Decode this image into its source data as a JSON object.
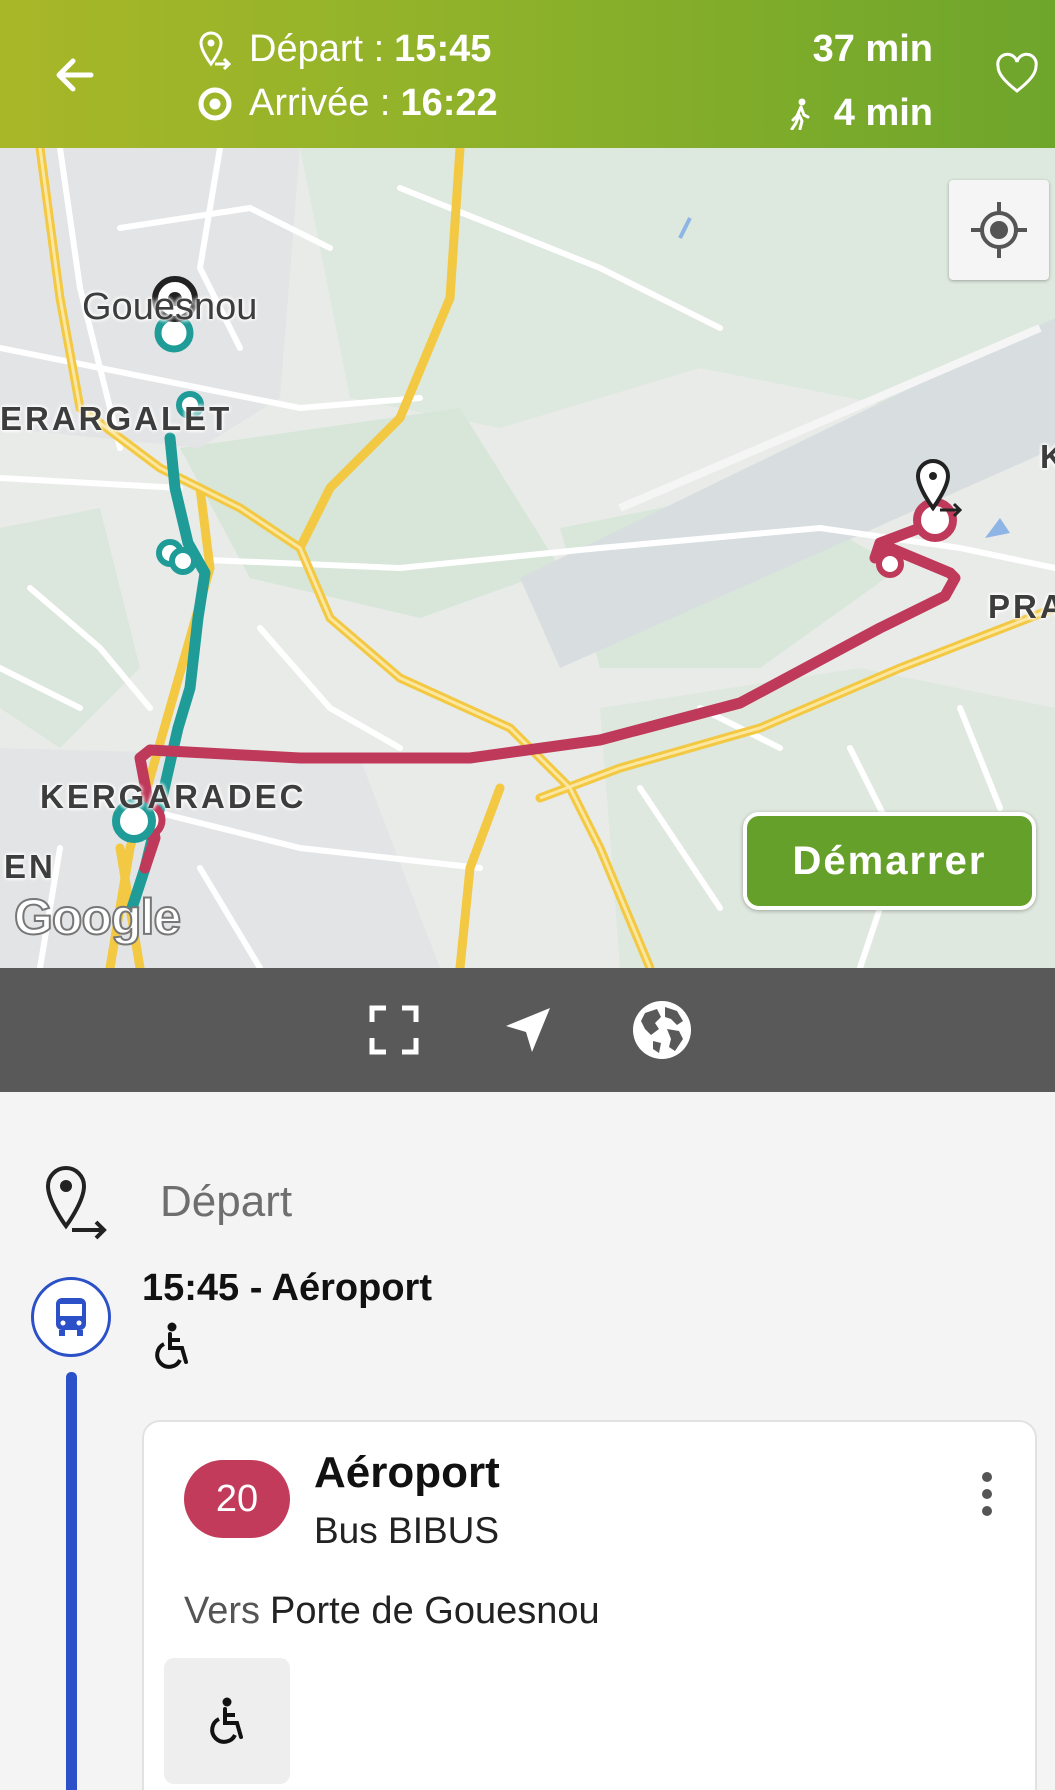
{
  "header": {
    "departure_label": "Départ :",
    "departure_time": "15:45",
    "arrival_label": "Arrivée :",
    "arrival_time": "16:22",
    "duration": "37 min",
    "walk_duration": "4 min",
    "colors": {
      "gradient_start": "#a8b728",
      "gradient_end": "#6ea52b"
    }
  },
  "map": {
    "labels": {
      "town": "Gouesnou",
      "kerargalet": "ERARGALET",
      "kergaradec": "KERGARADEC",
      "en": "EN",
      "pra": "PRA",
      "k": "K"
    },
    "start_button": "Démarrer",
    "attribution": "Google",
    "route_colors": {
      "bus": "#bf3a5a",
      "tram": "#1f9c98"
    }
  },
  "toolbar": {
    "icons": [
      "fullscreen-icon",
      "navigation-arrow-icon",
      "globe-icon"
    ]
  },
  "details": {
    "departure_label": "Départ",
    "stop_title": "15:45 - Aéroport",
    "card": {
      "line_number": "20",
      "line_color": "#c23b5a",
      "title": "Aéroport",
      "subtitle": "Bus BIBUS",
      "towards_prefix": "Vers",
      "towards_dest": "Porte de Gouesnou"
    }
  }
}
